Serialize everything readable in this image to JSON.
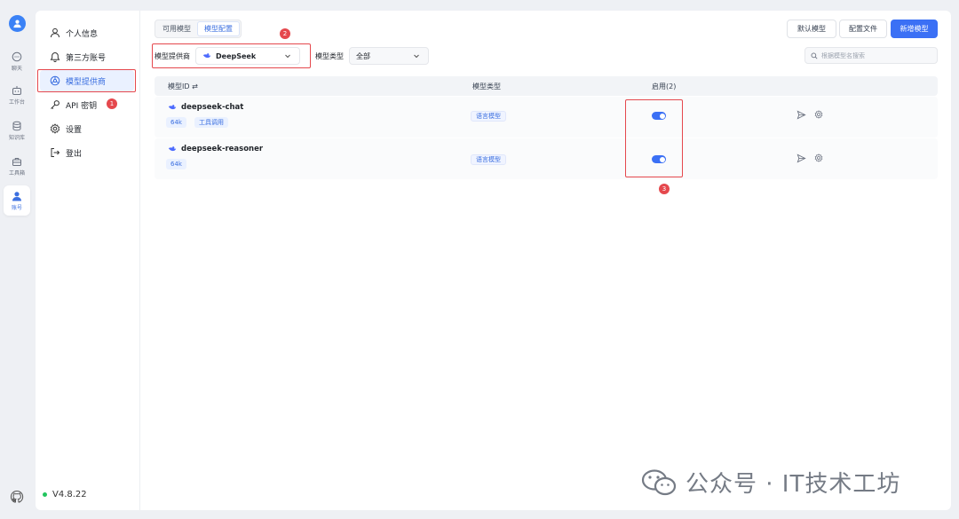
{
  "rail": {
    "items": [
      {
        "label": "聊天",
        "icon": "chat-icon"
      },
      {
        "label": "工作台",
        "icon": "robot-icon"
      },
      {
        "label": "知识库",
        "icon": "database-icon"
      },
      {
        "label": "工具箱",
        "icon": "toolbox-icon"
      },
      {
        "label": "账号",
        "icon": "user-icon"
      }
    ]
  },
  "sidebar": {
    "items": [
      {
        "label": "个人信息",
        "icon": "user-outline-icon"
      },
      {
        "label": "第三方账号",
        "icon": "bell-icon"
      },
      {
        "label": "模型提供商",
        "icon": "model-provider-icon"
      },
      {
        "label": "API 密钥",
        "icon": "key-icon"
      },
      {
        "label": "设置",
        "icon": "settings-icon"
      },
      {
        "label": "登出",
        "icon": "logout-icon"
      }
    ],
    "version": "V4.8.22"
  },
  "tabs": [
    {
      "label": "可用模型"
    },
    {
      "label": "模型配置"
    }
  ],
  "toolbar": {
    "default_model": "默认模型",
    "config_file": "配置文件",
    "add_model": "新增模型"
  },
  "filters": {
    "provider_label": "模型提供商",
    "provider_value": "DeepSeek",
    "type_label": "模型类型",
    "type_value": "全部",
    "search_placeholder": "根据模型名搜索"
  },
  "table": {
    "headers": {
      "model_id": "模型ID",
      "model_type": "模型类型",
      "enabled": "启用(2)"
    },
    "rows": [
      {
        "name": "deepseek-chat",
        "tags": [
          "64k",
          "工具调用"
        ],
        "type": "语言模型",
        "enabled": true
      },
      {
        "name": "deepseek-reasoner",
        "tags": [
          "64k"
        ],
        "type": "语言模型",
        "enabled": true
      }
    ]
  },
  "annotations": {
    "n1": "1",
    "n2": "2",
    "n3": "3"
  },
  "watermark": "公众号 · IT技术工坊",
  "colors": {
    "accent": "#3b70f5",
    "annotation": "#e5484d"
  }
}
